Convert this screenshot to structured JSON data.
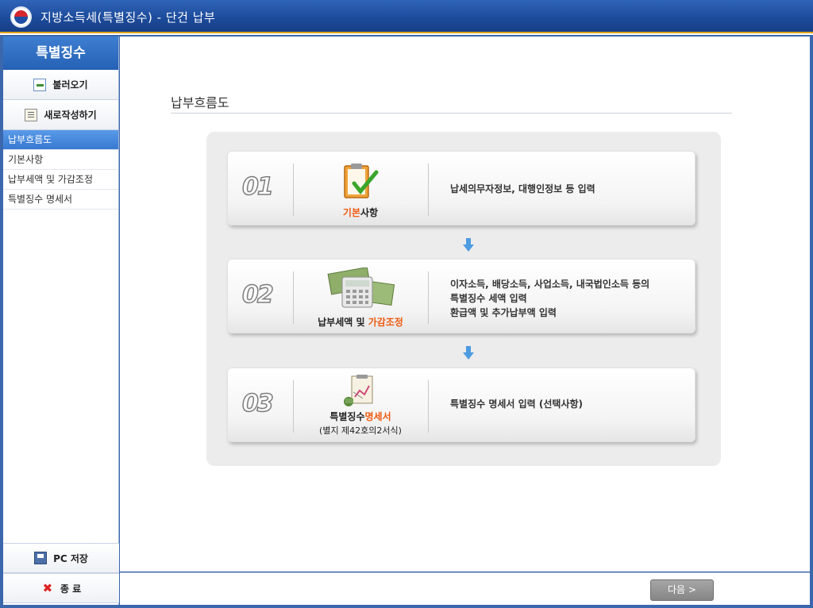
{
  "window": {
    "title": "지방소득세(특별징수) - 단건 납부"
  },
  "sidebar": {
    "header": "특별징수",
    "load_button": {
      "label": "불러오기",
      "icon": "document-open-icon"
    },
    "new_button": {
      "label": "새로작성하기",
      "icon": "document-write-icon"
    },
    "items": [
      {
        "label": "납부흐름도",
        "active": true
      },
      {
        "label": "기본사항",
        "active": false
      },
      {
        "label": "납부세액 및 가감조정",
        "active": false
      },
      {
        "label": "특별징수 명세서",
        "active": false
      }
    ],
    "save_button": {
      "label": "PC 저장",
      "icon": "floppy-disk-icon"
    },
    "exit_button": {
      "label": "종 료",
      "icon": "close-x-icon"
    }
  },
  "main": {
    "page_title": "납부흐름도",
    "steps": [
      {
        "number": "01",
        "icon": "clipboard-check-icon",
        "caption_highlight": "기본",
        "caption_rest": "사항",
        "desc": [
          "납세의무자정보, 대행인정보 등 입력"
        ]
      },
      {
        "number": "02",
        "icon": "calculator-money-icon",
        "caption_prefix": "납부세액 및 ",
        "caption_highlight": "가감조정",
        "desc": [
          "이자소득, 배당소득, 사업소득, 내국법인소득 등의",
          "특별징수 세액 입력",
          "환급액 및 추가납부액 입력"
        ]
      },
      {
        "number": "03",
        "icon": "statement-document-icon",
        "caption_prefix": "특별징수",
        "caption_highlight": "명세서",
        "caption_sub": "(별지 제42호의2서식)",
        "desc": [
          "특별징수 명세서 입력 (선택사항)"
        ]
      }
    ]
  },
  "footer": {
    "next_button": "다음 >"
  },
  "colors": {
    "titlebar": "#1c4a9a",
    "accent": "#e0a21c",
    "highlight_text": "#ef5b13",
    "active_menu": "#3779d2",
    "flow_arrow": "#4d9be0"
  }
}
